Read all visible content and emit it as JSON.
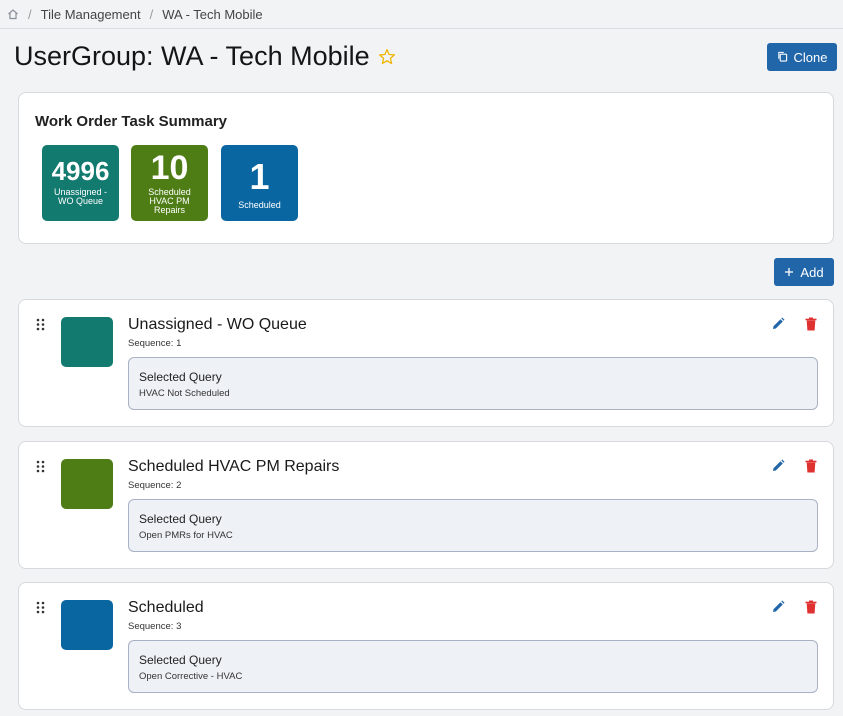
{
  "breadcrumb": {
    "icon": "home-icon",
    "items": [
      "Tile Management",
      "WA - Tech Mobile"
    ],
    "separator": "/"
  },
  "header": {
    "title": "UserGroup: WA - Tech Mobile",
    "favorite_icon": "star-outline-icon",
    "clone_label": "Clone",
    "clone_icon": "copy-icon"
  },
  "summary": {
    "title": "Work Order Task Summary",
    "tiles": [
      {
        "value": "4996",
        "label": "Unassigned - WO Queue",
        "color": "#137a70"
      },
      {
        "value": "10",
        "label": "Scheduled HVAC PM Repairs",
        "color": "#4f7d15"
      },
      {
        "value": "1",
        "label": "Scheduled",
        "color": "#0a66a1"
      }
    ]
  },
  "add_label": "Add",
  "add_icon": "plus-icon",
  "groups": [
    {
      "title": "Unassigned - WO Queue",
      "sequence": "Sequence: 1",
      "color": "#137a70",
      "query_label": "Selected Query",
      "query_value": "HVAC Not Scheduled"
    },
    {
      "title": "Scheduled HVAC PM Repairs",
      "sequence": "Sequence: 2",
      "color": "#4f7d15",
      "query_label": "Selected Query",
      "query_value": "Open PMRs for HVAC"
    },
    {
      "title": "Scheduled",
      "sequence": "Sequence: 3",
      "color": "#0a66a1",
      "query_label": "Selected Query",
      "query_value": "Open Corrective - HVAC"
    }
  ],
  "colors": {
    "primary": "#2266aa",
    "edit": "#2266aa",
    "delete": "#e03131",
    "star": "#f0b400"
  }
}
